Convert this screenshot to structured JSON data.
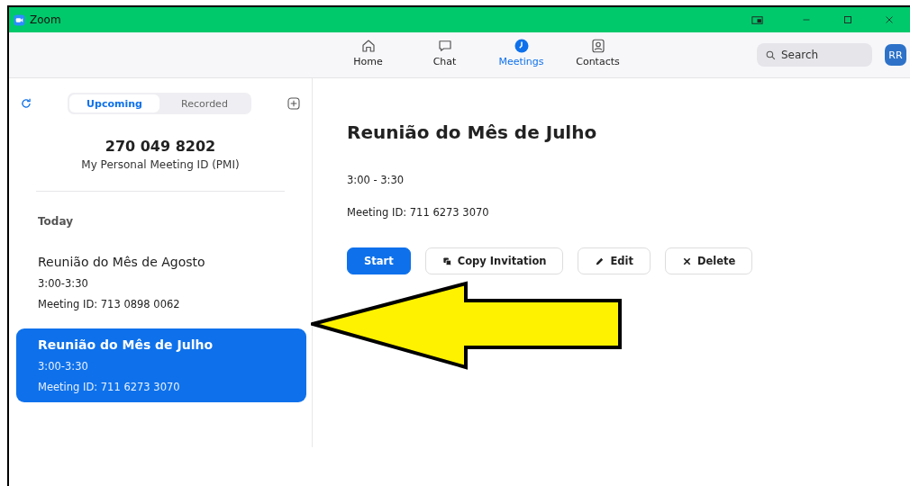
{
  "window": {
    "title": "Zoom"
  },
  "nav_tabs": [
    {
      "label": "Home",
      "selected": false
    },
    {
      "label": "Chat",
      "selected": false
    },
    {
      "label": "Meetings",
      "selected": true
    },
    {
      "label": "Contacts",
      "selected": false
    }
  ],
  "search": {
    "placeholder": "Search"
  },
  "avatar": {
    "initials": "RR"
  },
  "sidebar": {
    "tabs": [
      {
        "label": "Upcoming",
        "selected": true
      },
      {
        "label": "Recorded",
        "selected": false
      }
    ],
    "pmi": {
      "number": "270 049 8202",
      "label": "My Personal Meeting ID (PMI)"
    },
    "section": "Today",
    "meetings": [
      {
        "title": "Reunião do Mês de Agosto",
        "time": "3:00-3:30",
        "meeting_id": "Meeting ID: 713 0898 0062",
        "selected": false
      },
      {
        "title": "Reunião do Mês de Julho",
        "time": "3:00-3:30",
        "meeting_id": "Meeting ID: 711 6273 3070",
        "selected": true
      }
    ]
  },
  "detail": {
    "title": "Reunião do Mês de Julho",
    "time": "3:00 - 3:30",
    "meeting_id": "Meeting ID: 711 6273 3070",
    "buttons": [
      {
        "label": "Start",
        "kind": "primary"
      },
      {
        "label": "Copy Invitation",
        "kind": "copy"
      },
      {
        "label": "Edit",
        "kind": "edit"
      },
      {
        "label": "Delete",
        "kind": "delete"
      }
    ]
  }
}
